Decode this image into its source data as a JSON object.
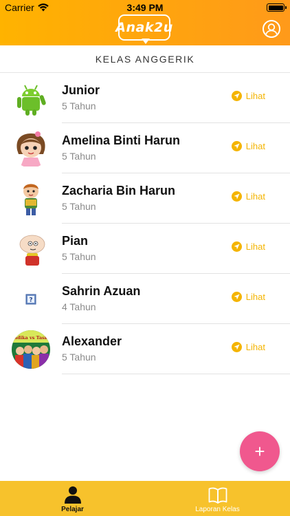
{
  "status_bar": {
    "carrier": "Carrier",
    "time": "3:49 PM"
  },
  "header": {
    "logo_text": "Anak2u"
  },
  "section": {
    "title": "KELAS ANGGERIK"
  },
  "students": [
    {
      "name": "Junior",
      "age": "5 Tahun",
      "action": "Lihat",
      "avatar": "android-robot"
    },
    {
      "name": "Amelina Binti Harun",
      "age": "5 Tahun",
      "action": "Lihat",
      "avatar": "cartoon-girl"
    },
    {
      "name": "Zacharia Bin Harun",
      "age": "5 Tahun",
      "action": "Lihat",
      "avatar": "cartoon-boy"
    },
    {
      "name": "Pian",
      "age": "5 Tahun",
      "action": "Lihat",
      "avatar": "stewie"
    },
    {
      "name": "Sahrin Azuan",
      "age": "4 Tahun",
      "action": "Lihat",
      "avatar": "missing-image"
    },
    {
      "name": "Alexander",
      "age": "5 Tahun",
      "action": "Lihat",
      "avatar": "tadika-vs-taska",
      "avatar_text": "Tadika vs Taska"
    }
  ],
  "fab": {
    "label": "+"
  },
  "tabbar": {
    "tabs": [
      {
        "label": "Pelajar",
        "active": true,
        "icon": "person-icon"
      },
      {
        "label": "Laporan Kelas",
        "active": false,
        "icon": "book-icon"
      }
    ]
  },
  "colors": {
    "header": "#ffa40e",
    "accent": "#f4b400",
    "fab": "#f0588e",
    "tabbar": "#f7c22c"
  }
}
